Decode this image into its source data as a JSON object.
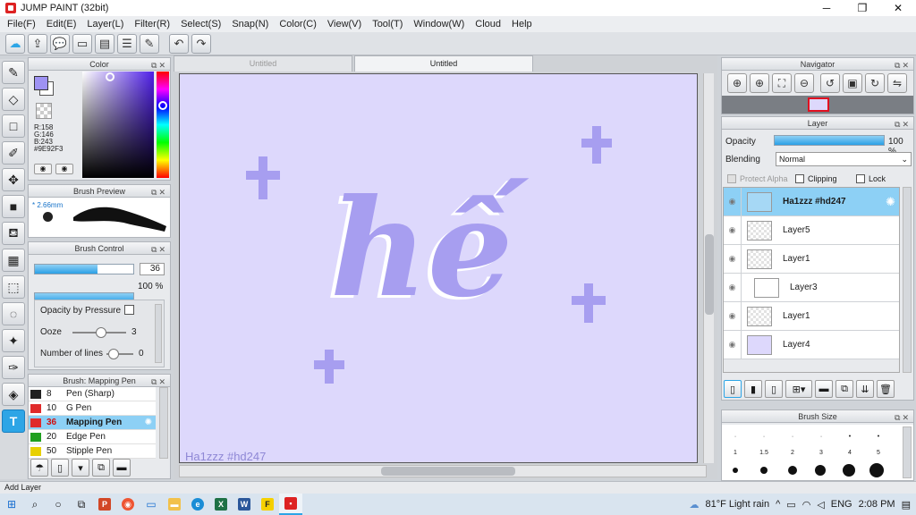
{
  "window": {
    "title": "JUMP PAINT (32bit)",
    "min": "─",
    "max": "❐",
    "close": "✕"
  },
  "menu": [
    "File(F)",
    "Edit(E)",
    "Layer(L)",
    "Filter(R)",
    "Select(S)",
    "Snap(N)",
    "Color(C)",
    "View(V)",
    "Tool(T)",
    "Window(W)",
    "Cloud",
    "Help"
  ],
  "colors": {
    "accent": "#2DA5E6",
    "foreground": "#9E92F3",
    "canvas_bg": "#DDD8FC",
    "art": "#A79EF0",
    "selection": "#8DD0F5"
  },
  "color_panel": {
    "title": "Color",
    "r": "R:158",
    "g": "G:146",
    "b": "B:243",
    "hex": "#9E92F3"
  },
  "brush_preview": {
    "title": "Brush Preview",
    "size": "2.66mm"
  },
  "brush_control": {
    "title": "Brush Control",
    "size_value": "36",
    "opacity_value": "100 %",
    "opacity_by_pressure": "Opacity by Pressure",
    "ooze_label": "Ooze",
    "ooze_value": "3",
    "lines_label": "Number of lines",
    "lines_value": "0"
  },
  "brush_list": {
    "title": "Brush: Mapping Pen",
    "items": [
      {
        "num": "8",
        "name": "Pen (Sharp)",
        "color": "#222222"
      },
      {
        "num": "10",
        "name": "G Pen",
        "color": "#e02a2a"
      },
      {
        "num": "36",
        "name": "Mapping Pen",
        "color": "#e02a2a"
      },
      {
        "num": "20",
        "name": "Edge Pen",
        "color": "#20a020"
      },
      {
        "num": "50",
        "name": "Stipple Pen",
        "color": "#e8d000"
      }
    ]
  },
  "tabs": [
    "Untitled",
    "Untitled"
  ],
  "canvas": {
    "signature": "Ha1zzz #hd247",
    "word": "hế"
  },
  "navigator": {
    "title": "Navigator"
  },
  "layer_panel": {
    "title": "Layer",
    "opacity_label": "Opacity",
    "opacity_value": "100 %",
    "blending_label": "Blending",
    "blending_value": "Normal",
    "protect_alpha": "Protect Alpha",
    "clipping": "Clipping",
    "lock": "Lock",
    "layers": [
      "Ha1zzz #hd247",
      "Layer5",
      "Layer1",
      "Layer3",
      "Layer1",
      "Layer4"
    ]
  },
  "brush_size": {
    "title": "Brush Size",
    "labels": [
      "1",
      "1.5",
      "2",
      "3",
      "4",
      "5"
    ]
  },
  "status": "Add Layer",
  "tray": {
    "weather": "81°F  Light rain",
    "lang": "ENG",
    "time": "2:08 PM"
  }
}
